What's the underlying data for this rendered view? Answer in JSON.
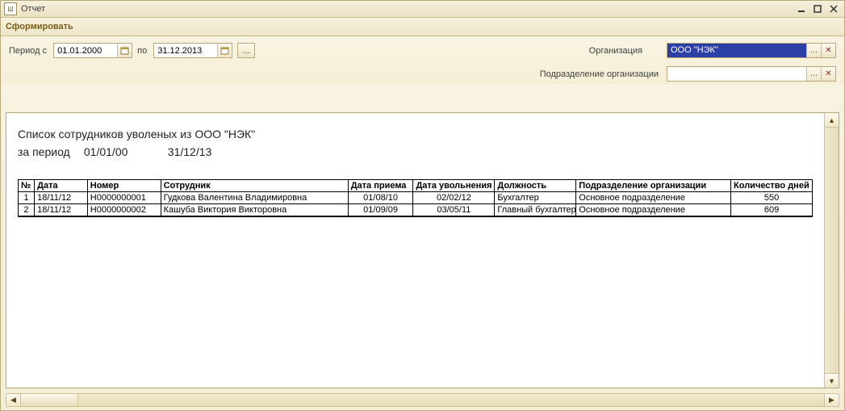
{
  "window": {
    "title": "Отчет",
    "app_icon_text": "Ш"
  },
  "toolbar": {
    "form_label": "Сформировать"
  },
  "filters": {
    "period_label": "Период с",
    "period_from": "01.01.2000",
    "period_to_label": "по",
    "period_to": "31.12.2013",
    "ellipsis": "...",
    "org_label": "Организация",
    "org_value": "ООО \"НЭК\"",
    "dept_label": "Подразделение организации",
    "dept_value": ""
  },
  "report": {
    "title": "Список сотрудников уволеных из ООО \"НЭК\"",
    "period_label": "за период",
    "period_from": "01/01/00",
    "period_to": "31/12/13",
    "headers": {
      "no": "№",
      "date": "Дата",
      "number": "Номер",
      "employee": "Сотрудник",
      "hire_date": "Дата приема",
      "fire_date": "Дата увольнения",
      "position": "Должность",
      "department": "Подразделение организации",
      "days": "Количество дней"
    },
    "rows": [
      {
        "no": "1",
        "date": "18/11/12",
        "number": "Н0000000001",
        "employee": "Гудкова Валентина Владимировна",
        "hire_date": "01/08/10",
        "fire_date": "02/02/12",
        "position": "Бухгалтер",
        "department": "Основное подразделение",
        "days": "550"
      },
      {
        "no": "2",
        "date": "18/11/12",
        "number": "Н0000000002",
        "employee": "Кашуба Виктория Викторовна",
        "hire_date": "01/09/09",
        "fire_date": "03/05/11",
        "position": "Главный бухгалтер",
        "department": "Основное подразделение",
        "days": "609"
      }
    ]
  }
}
